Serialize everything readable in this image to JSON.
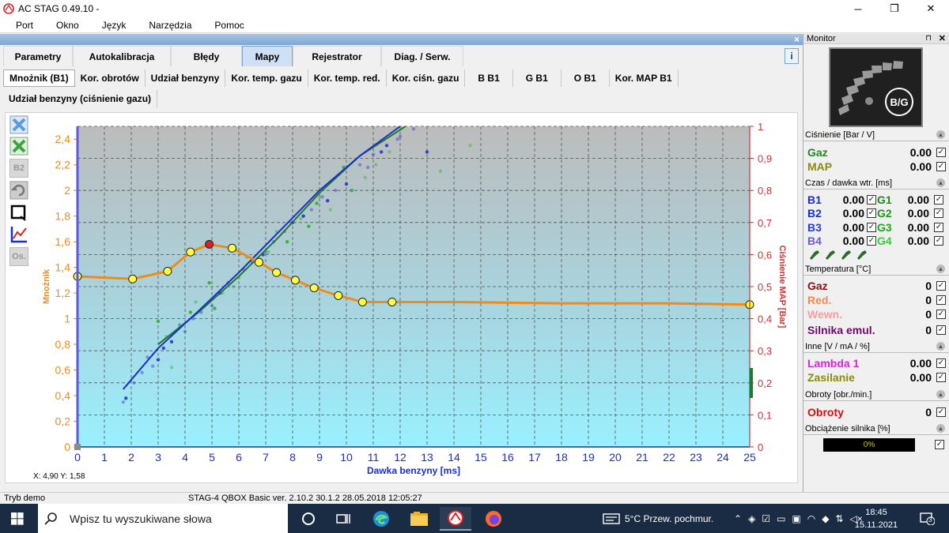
{
  "window": {
    "title": "AC STAG 0.49.10 -",
    "minimize": "─",
    "maximize": "❐",
    "close": "✕"
  },
  "menu": [
    "Port",
    "Okno",
    "Język",
    "Narzędzia",
    "Pomoc"
  ],
  "doc_close": "×",
  "tabs_main": [
    {
      "label": "Parametry",
      "active": false
    },
    {
      "label": "Autokalibracja",
      "active": false
    },
    {
      "label": "Błędy",
      "active": false
    },
    {
      "label": "Mapy",
      "active": true
    },
    {
      "label": "Rejestrator",
      "active": false
    },
    {
      "label": "Diag. / Serw.",
      "active": false
    }
  ],
  "help_label": "i",
  "tabs_sub": [
    {
      "label": "Mnożnik (B1)",
      "active": true
    },
    {
      "label": "Kor. obrotów",
      "active": false
    },
    {
      "label": "Udział benzyny",
      "active": false
    },
    {
      "label": "Kor. temp. gazu",
      "active": false
    },
    {
      "label": "Kor. temp. red.",
      "active": false
    },
    {
      "label": "Kor. ciśn. gazu",
      "active": false
    },
    {
      "label": "B B1",
      "active": false
    },
    {
      "label": "G B1",
      "active": false
    },
    {
      "label": "O B1",
      "active": false
    },
    {
      "label": "Kor. MAP B1",
      "active": false
    }
  ],
  "tabs_sub2": [
    {
      "label": "Udział benzyny (ciśnienie gazu)",
      "active": false
    }
  ],
  "tools": [
    {
      "name": "clear-blue-icon",
      "label": ""
    },
    {
      "name": "clear-green-icon",
      "label": ""
    },
    {
      "name": "b2-button",
      "label": "B2"
    },
    {
      "name": "refresh-icon",
      "label": ""
    },
    {
      "name": "frame-icon",
      "label": ""
    },
    {
      "name": "axis-icon",
      "label": ""
    },
    {
      "name": "os-button",
      "label": "Os."
    }
  ],
  "coords_text": "X: 4,90  Y: 1,58",
  "chart_data": {
    "type": "line",
    "xlabel": "Dawka benzyny [ms]",
    "ylabel": "Mnożnik",
    "y2label": "Ciśnienie MAP [Bar]",
    "xlim": [
      0,
      25
    ],
    "ylim": [
      0,
      2.5
    ],
    "y2lim": [
      0,
      1
    ],
    "x_ticks": [
      "0",
      "1",
      "2",
      "3",
      "4",
      "5",
      "6",
      "7",
      "8",
      "9",
      "10",
      "11",
      "12",
      "13",
      "14",
      "15",
      "16",
      "17",
      "18",
      "19",
      "20",
      "21",
      "22",
      "23",
      "24",
      "25"
    ],
    "y_ticks": [
      "0",
      "0,2",
      "0,4",
      "0,6",
      "0,8",
      "1",
      "1,2",
      "1,4",
      "1,6",
      "1,8",
      "2",
      "2,2",
      "2,4"
    ],
    "y2_ticks": [
      "0",
      "0,1",
      "0,2",
      "0,3",
      "0,4",
      "0,5",
      "0,6",
      "0,7",
      "0,8",
      "0,9",
      "1"
    ],
    "grid": true,
    "multiplier_curve": {
      "name": "Mnożnik",
      "color": "#f08a1a",
      "x": [
        0,
        2.05,
        3.35,
        4.2,
        4.9,
        5.75,
        6.75,
        7.4,
        8.1,
        8.8,
        9.7,
        10.6,
        11.7,
        14,
        18,
        22,
        25
      ],
      "y": [
        1.33,
        1.31,
        1.37,
        1.52,
        1.58,
        1.55,
        1.44,
        1.36,
        1.3,
        1.24,
        1.18,
        1.13,
        1.13,
        1.13,
        1.12,
        1.12,
        1.11
      ],
      "points_x": [
        0,
        2.05,
        3.35,
        4.2,
        4.9,
        5.75,
        6.75,
        7.4,
        8.1,
        8.8,
        9.7,
        10.6,
        11.7,
        25
      ],
      "points_y": [
        1.33,
        1.31,
        1.37,
        1.52,
        1.58,
        1.55,
        1.44,
        1.36,
        1.3,
        1.24,
        1.18,
        1.13,
        1.13,
        1.11
      ],
      "selected_index": 4
    },
    "trend_blue": {
      "color": "#1a2ecc",
      "x": [
        1.7,
        3,
        4.5,
        6,
        7.5,
        9,
        10.5,
        12
      ],
      "y": [
        0.45,
        0.77,
        1.06,
        1.36,
        1.68,
        2.0,
        2.27,
        2.5
      ]
    },
    "trend_green": {
      "color": "#1f7a2a",
      "x": [
        3,
        4.5,
        6,
        7.5,
        9,
        10.5,
        12.2
      ],
      "y": [
        0.8,
        1.05,
        1.33,
        1.64,
        1.98,
        2.27,
        2.5
      ]
    },
    "scatter_blue": {
      "color": "#2f3ed0",
      "x": [
        1.8,
        2.1,
        2.8,
        3.2,
        3.8,
        4.6,
        5.3,
        6.2,
        7.3,
        8.0,
        9.1,
        10.5,
        11.5,
        1.7,
        2.4,
        3.0,
        4.0,
        5.6,
        6.9,
        7.7,
        8.7,
        10.0,
        11.0,
        12.0,
        3.5,
        6.5,
        9.6,
        11.3,
        2.6,
        5.0,
        8.4,
        10.8,
        12.5,
        13.0,
        4.3,
        7.0,
        9.3,
        11.9
      ],
      "y": [
        0.38,
        0.5,
        0.63,
        0.77,
        0.95,
        1.05,
        1.2,
        1.38,
        1.6,
        1.75,
        1.95,
        2.2,
        2.35,
        0.35,
        0.58,
        0.68,
        0.9,
        1.28,
        1.5,
        1.68,
        1.85,
        2.05,
        2.28,
        2.42,
        0.82,
        1.44,
        2.0,
        2.3,
        0.7,
        1.1,
        1.8,
        2.18,
        2.48,
        2.3,
        1.0,
        1.52,
        1.92,
        2.4
      ]
    },
    "scatter_green": {
      "color": "#2db52d",
      "x": [
        3.0,
        3.5,
        4.4,
        5.1,
        5.8,
        6.7,
        7.8,
        8.3,
        9.4,
        10.2,
        11.1,
        3.3,
        4.9,
        6.3,
        7.4,
        8.9,
        10.7,
        5.4,
        9.9,
        13.5,
        14.6,
        4.2,
        6.0,
        7.1,
        8.6,
        9.0,
        11.6
      ],
      "y": [
        0.98,
        0.62,
        1.13,
        1.08,
        1.25,
        1.42,
        1.6,
        1.78,
        1.85,
        2.0,
        2.2,
        0.86,
        1.28,
        1.48,
        1.68,
        1.9,
        2.1,
        1.2,
        2.18,
        2.15,
        2.35,
        1.05,
        1.32,
        1.52,
        1.72,
        1.95,
        2.3
      ]
    }
  },
  "monitor": {
    "title": "Monitor",
    "pin": "⊓",
    "close": "✕",
    "gauge_label": "B/G",
    "sections": {
      "pressure": "Ciśnienie [Bar / V]",
      "injection": "Czas / dawka wtr. [ms]",
      "temperature": "Temperatura [°C]",
      "other": "Inne [V / mA / %]",
      "rpm": "Obroty [obr./min.]",
      "load": "Obciążenie silnika [%]"
    },
    "pressure_rows": [
      {
        "label": "Gaz",
        "value": "0.00",
        "color": "#1a8a1a"
      },
      {
        "label": "MAP",
        "value": "0.00",
        "color": "#8a8a10"
      }
    ],
    "injection_rows": [
      {
        "b": "B1",
        "bval": "0.00",
        "g": "G1",
        "gval": "0.00"
      },
      {
        "b": "B2",
        "bval": "0.00",
        "g": "G2",
        "gval": "0.00"
      },
      {
        "b": "B3",
        "bval": "0.00",
        "g": "G3",
        "gval": "0.00"
      },
      {
        "b": "B4",
        "bval": "0.00",
        "g": "G4",
        "gval": "0.00"
      }
    ],
    "injection_colors": [
      "#1a2ecc",
      "#1a2ecc",
      "#2a3ecc",
      "#6b5ad8"
    ],
    "injection_g_colors": [
      "#1a8a1a",
      "#1a9a1a",
      "#1aaa1a",
      "#2bd62b"
    ],
    "temperature_rows": [
      {
        "label": "Gaz",
        "value": "0",
        "color": "#8a1010"
      },
      {
        "label": "Red.",
        "value": "0",
        "color": "#f08a50"
      },
      {
        "label": "Wewn.",
        "value": "0",
        "color": "#f0a0a0"
      },
      {
        "label": "Silnika emul.",
        "value": "0",
        "color": "#6a0a6a"
      }
    ],
    "other_rows": [
      {
        "label": "Lambda 1",
        "value": "0.00",
        "color": "#e020e0"
      },
      {
        "label": "Zasilanie",
        "value": "0.00",
        "color": "#8a8a10"
      }
    ],
    "rpm_rows": [
      {
        "label": "Obroty",
        "value": "0",
        "color": "#d01010"
      }
    ],
    "load_value": "0%",
    "check": "✓"
  },
  "status": {
    "mode": "Tryb demo",
    "version": "STAG-4 QBOX Basic  ver. 2.10.2  30.1.2   28.05.2018 12:05:27"
  },
  "taskbar": {
    "search_placeholder": "Wpisz tu wyszukiwane słowa",
    "weather": "5°C  Przew. pochmur.",
    "time": "18:45",
    "date": "15.11.2021",
    "notifications": "3"
  }
}
